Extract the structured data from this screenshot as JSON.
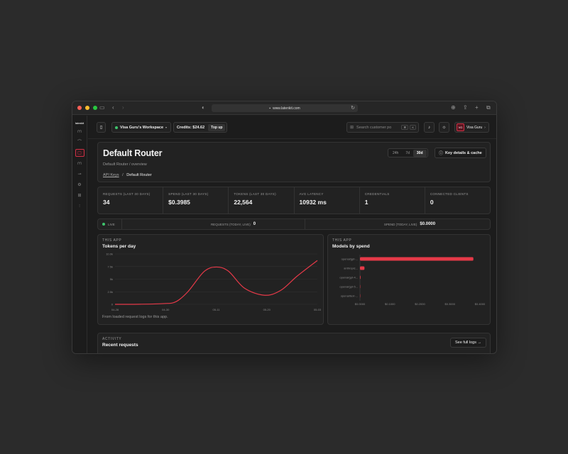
{
  "browser": {
    "url": "www.latenkit.com",
    "traffic_lights": [
      "#ff5f57",
      "#febc2e",
      "#28c840"
    ]
  },
  "sidebar": {
    "logo": "latenkit",
    "items": [
      {
        "icon": "chart-icon",
        "glyph": "⩋"
      },
      {
        "icon": "activity-icon",
        "glyph": "⌒"
      },
      {
        "icon": "router-icon",
        "glyph": "▢",
        "active": true
      },
      {
        "icon": "stats-icon",
        "glyph": "⩋"
      },
      {
        "icon": "key-icon",
        "glyph": "⊸"
      },
      {
        "icon": "settings-icon",
        "glyph": "⚙"
      },
      {
        "icon": "grid-icon",
        "glyph": "⊞"
      },
      {
        "icon": "bars-icon",
        "glyph": "⫶"
      }
    ]
  },
  "topbar": {
    "workspace": "Visa Guru's Workspace",
    "credits": "Credits: $24.62",
    "topup": "Top up",
    "search_placeholder": "Search customer po",
    "kbd": [
      "⌘",
      "K"
    ],
    "avatar_initials": "VG",
    "user": "Visa Guru"
  },
  "hero": {
    "title": "Default Router",
    "subtitle": "Default Router / overview",
    "breadcrumb_link": "API Keys",
    "breadcrumb_sep": "/",
    "breadcrumb_current": "Default Router",
    "ranges": [
      "24h",
      "7d",
      "30d"
    ],
    "selected_range": "30d",
    "key_button": "Key details & cache"
  },
  "stats": [
    {
      "label": "REQUESTS (LAST 30 DAYS)",
      "value": "34"
    },
    {
      "label": "SPEND (LAST 30 DAYS)",
      "value": "$0.3985"
    },
    {
      "label": "TOKENS (LAST 30 DAYS)",
      "value": "22,564"
    },
    {
      "label": "AVG LATENCY",
      "value": "10932 ms"
    },
    {
      "label": "CREDENTIALS",
      "value": "1"
    },
    {
      "label": "CONNECTED CLIENTS",
      "value": "0"
    }
  ],
  "live": {
    "badge": "LIVE",
    "requests_label": "REQUESTS (TODAY, LIVE)",
    "requests_value": "0",
    "spend_label": "SPEND (TODAY, LIVE)",
    "spend_value": "$0.0000"
  },
  "tokens_panel": {
    "kicker": "THIS APP",
    "title": "Tokens per day",
    "footer": "From loaded request logs for this app."
  },
  "spend_panel": {
    "kicker": "THIS APP",
    "title": "Models by spend"
  },
  "chart_data": [
    {
      "type": "line",
      "y_ticks": [
        "0",
        "2.5k",
        "5k",
        "7.5k",
        "10.0k"
      ],
      "ylim": [
        0,
        10000
      ],
      "x_ticks": [
        "04-28",
        "04-30",
        "05-11",
        "05-20",
        "05-03"
      ],
      "line_color": "#e53948",
      "points": [
        [
          0,
          0
        ],
        [
          0.12,
          20
        ],
        [
          0.24,
          150
        ],
        [
          0.3,
          500
        ],
        [
          0.36,
          2500
        ],
        [
          0.44,
          6500
        ],
        [
          0.5,
          7400
        ],
        [
          0.56,
          6600
        ],
        [
          0.64,
          3200
        ],
        [
          0.74,
          1800
        ],
        [
          0.82,
          2800
        ],
        [
          0.9,
          5600
        ],
        [
          1.0,
          8700
        ]
      ]
    },
    {
      "type": "bar",
      "orientation": "horizontal",
      "categories": [
        "openai/gpt-...",
        "anthropic...",
        "openai/gpt-4...",
        "openai/gpt-5...",
        "openai/text-..."
      ],
      "values": [
        0.378,
        0.015,
        0.002,
        0.001,
        0.0005
      ],
      "xlim": [
        0,
        0.4
      ],
      "x_ticks": [
        "$0.0000",
        "$0.1000",
        "$0.2000",
        "$0.3000",
        "$0.4000"
      ],
      "bar_color": "#e53948"
    }
  ],
  "activity": {
    "kicker": "ACTIVITY",
    "title": "Recent requests",
    "see_full": "See full logs →"
  }
}
